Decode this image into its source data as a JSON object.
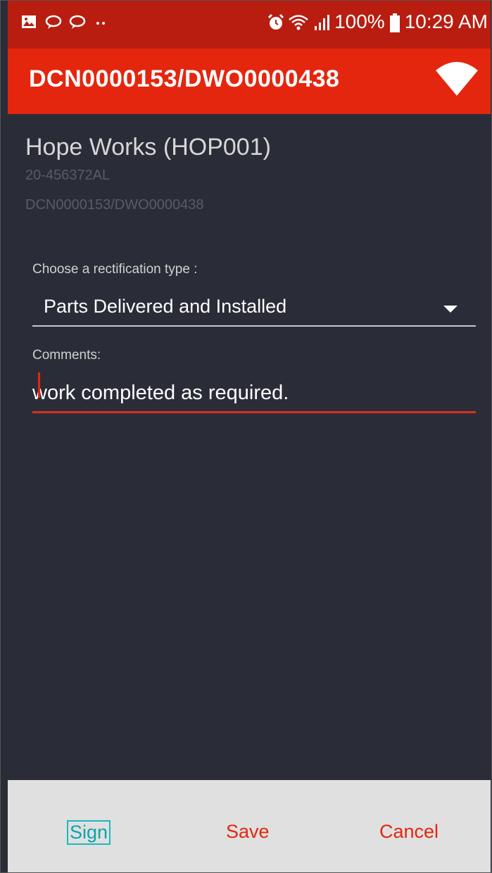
{
  "status_bar": {
    "battery": "100%",
    "time": "10:29 AM",
    "icons": [
      "image-icon",
      "chat-bubble-icon",
      "chat-bubble-icon",
      "more-dots-icon",
      "alarm-icon",
      "wifi-icon",
      "signal-icon",
      "battery-icon"
    ]
  },
  "app_bar": {
    "title": "DCN0000153/DWO0000438",
    "icon": "wifi-icon"
  },
  "site": {
    "name": "Hope Works (HOP001)",
    "serial": "20-456372AL",
    "reference": "DCN0000153/DWO0000438"
  },
  "form": {
    "rectification_label": "Choose a rectification type :",
    "rectification_value": "Parts Delivered and Installed",
    "comments_label": "Comments:",
    "comments_value": "work completed as required."
  },
  "actions": {
    "sign": "Sign",
    "save": "Save",
    "cancel": "Cancel"
  },
  "colors": {
    "status_bar": "#b81d10",
    "app_bar": "#e4260f",
    "background": "#2a2d38",
    "accent": "#e4260f",
    "bottom_bar": "#e0e0e0"
  }
}
